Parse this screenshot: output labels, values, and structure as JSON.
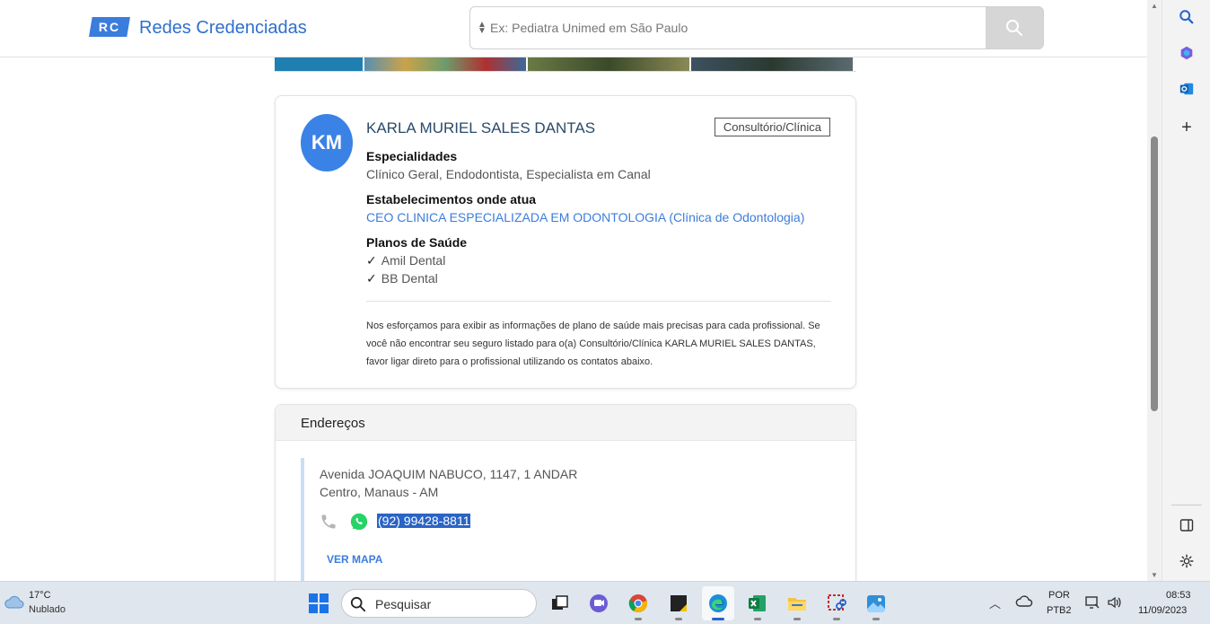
{
  "header": {
    "logo_badge": "RC",
    "logo_text": "Redes Credenciadas",
    "search_placeholder": "Ex: Pediatra Unimed em São Paulo"
  },
  "gallery": {
    "thumb_colors": [
      "#1f7fb0",
      "#5b8fb0",
      "#6b7a45",
      "#3d5160"
    ]
  },
  "profile": {
    "initials": "KM",
    "name": "KARLA MURIEL SALES DANTAS",
    "type_badge": "Consultório/Clínica",
    "specialties_title": "Especialidades",
    "specialties": "Clínico Geral, Endodontista, Especialista em Canal",
    "establishments_title": "Estabelecimentos onde atua",
    "establishment": "CEO CLINICA ESPECIALIZADA EM ODONTOLOGIA (Clínica de Odontologia)",
    "plans_title": "Planos de Saúde",
    "plans": [
      "Amil Dental",
      "BB Dental"
    ],
    "disclaimer": "Nos esforçamos para exibir as informações de plano de saúde mais precisas para cada profissional. Se você não encontrar seu seguro listado para o(a) Consultório/Clínica KARLA MURIEL SALES DANTAS, favor ligar direto para o profissional utilizando os contatos abaixo."
  },
  "addresses": {
    "title": "Endereços",
    "line1": "Avenida JOAQUIM NABUCO, 1147, 1 ANDAR",
    "line2": "Centro, Manaus - AM",
    "phone": "(92) 99428-8811",
    "map_link": "VER MAPA"
  },
  "taskbar": {
    "weather_temp": "17°C",
    "weather_cond": "Nublado",
    "search_label": "Pesquisar",
    "lang1": "POR",
    "lang2": "PTB2",
    "time": "08:53",
    "date": "11/09/2023"
  },
  "colors": {
    "accent": "#3b7ddd",
    "avatar": "#3b82e6",
    "selection": "#2a64c5",
    "whatsapp": "#25d366"
  }
}
